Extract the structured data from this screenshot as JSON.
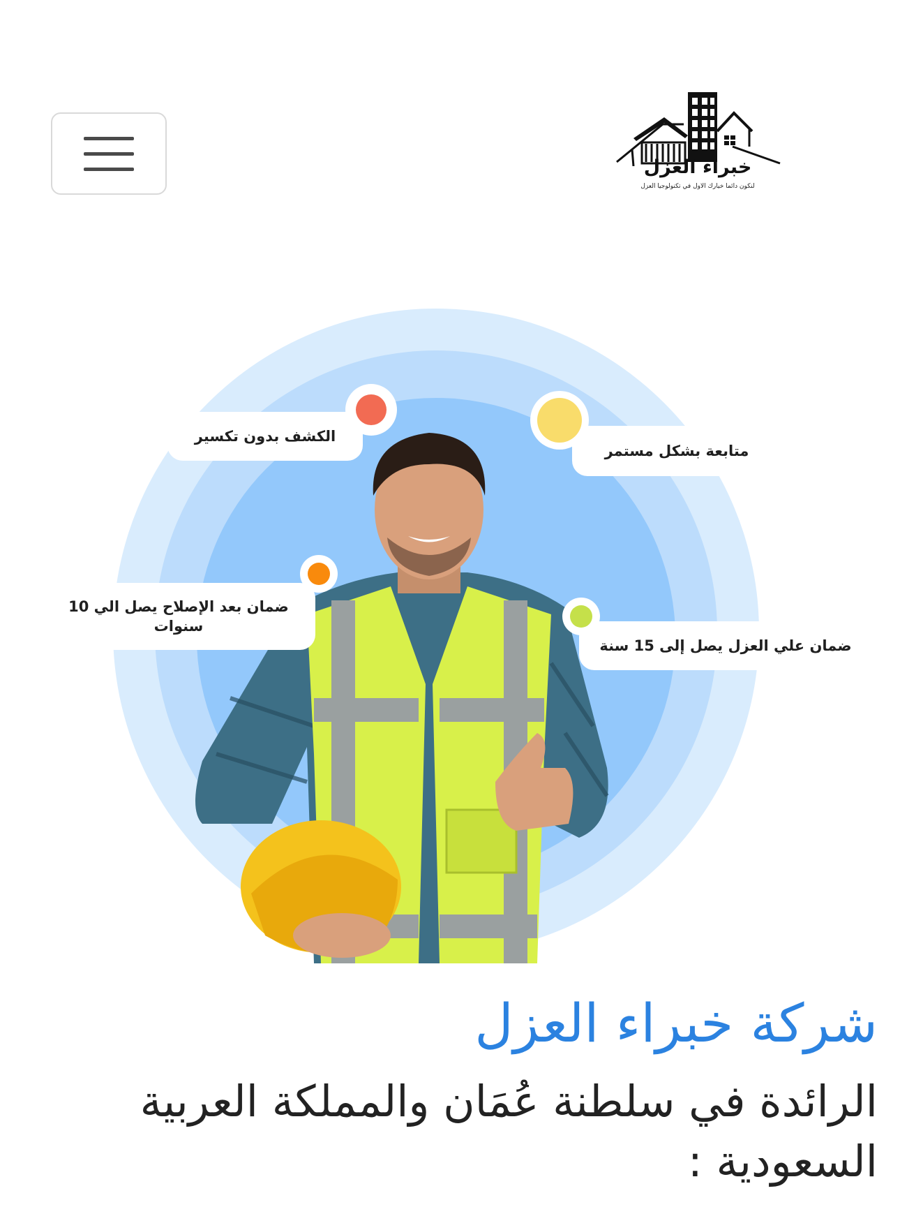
{
  "header": {
    "menu_icon": "hamburger-menu-icon",
    "logo": {
      "name": "خبراء العزل",
      "tagline": "لنكون دائما خيارك الاول في تكنولوجيا العزل"
    }
  },
  "hero": {
    "features": [
      {
        "label": "الكشف بدون تكسير",
        "dot_color": "#f26b53"
      },
      {
        "label": "متابعة بشكل مستمر",
        "dot_color": "#f9dc6b"
      },
      {
        "label": "ضمان بعد الإصلاح يصل الي 10 سنوات",
        "dot_color": "#f98a0c"
      },
      {
        "label": "ضمان علي العزل يصل إلى 15 سنة",
        "dot_color": "#c5e04a"
      }
    ],
    "image": "worker-in-safety-vest-holding-helmet"
  },
  "main": {
    "title": "شركة خبراء العزل",
    "subtitle": "الرائدة في سلطنة عُمَان والمملكة العربية السعودية :"
  },
  "colors": {
    "title": "#2b82e0",
    "ring_outer": "#d9ecfd",
    "ring_middle": "#bcdcfc",
    "ring_inner": "#93c8fb"
  }
}
